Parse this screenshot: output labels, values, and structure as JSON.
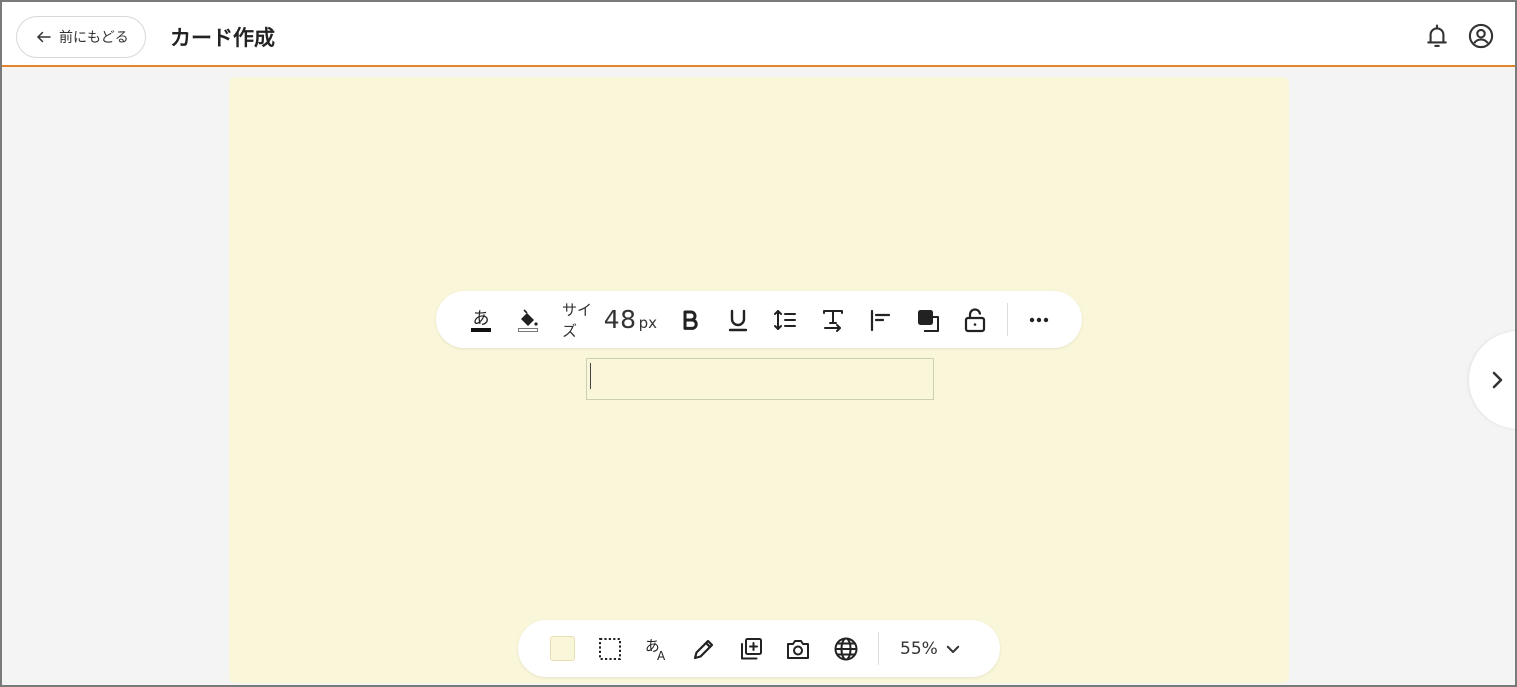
{
  "header": {
    "back_label": "前にもどる",
    "title": "カード作成"
  },
  "text_toolbar": {
    "font_color_glyph": "あ",
    "size_label": "サイズ",
    "size_value": "48",
    "size_unit": "px",
    "font_color": "#111111",
    "fill_color": "#ffffff"
  },
  "bottom_toolbar": {
    "background_swatch": "#faf6da",
    "text_glyph": "あ",
    "text_glyph_latin": "A",
    "zoom": "55%"
  },
  "colors": {
    "accent": "#e0862a",
    "canvas": "#faf6da"
  }
}
